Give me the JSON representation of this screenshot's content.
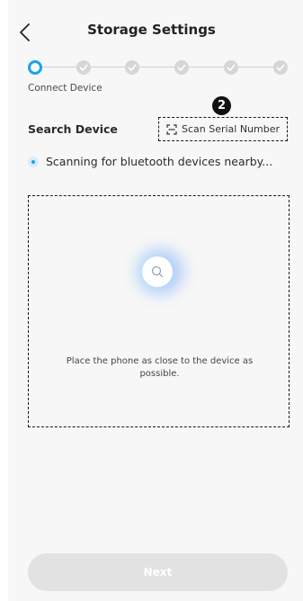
{
  "header": {
    "title": "Storage Settings",
    "back_icon": "chevron-left-icon"
  },
  "stepper": {
    "active_label": "Connect Device",
    "total_steps": 6,
    "current_step": 1,
    "active_color": "#1aa3e8",
    "pending_color": "#d6d6d6"
  },
  "search": {
    "section_title": "Search Device",
    "scan_button_label": "Scan Serial Number",
    "scan_icon": "scan-frame-icon",
    "badge_number": "2",
    "status_text": "Scanning for bluetooth devices nearby..."
  },
  "scan_area": {
    "icon": "search-icon",
    "hint": "Place the phone as close to the device as possible."
  },
  "footer": {
    "next_label": "Next",
    "next_disabled": true
  }
}
